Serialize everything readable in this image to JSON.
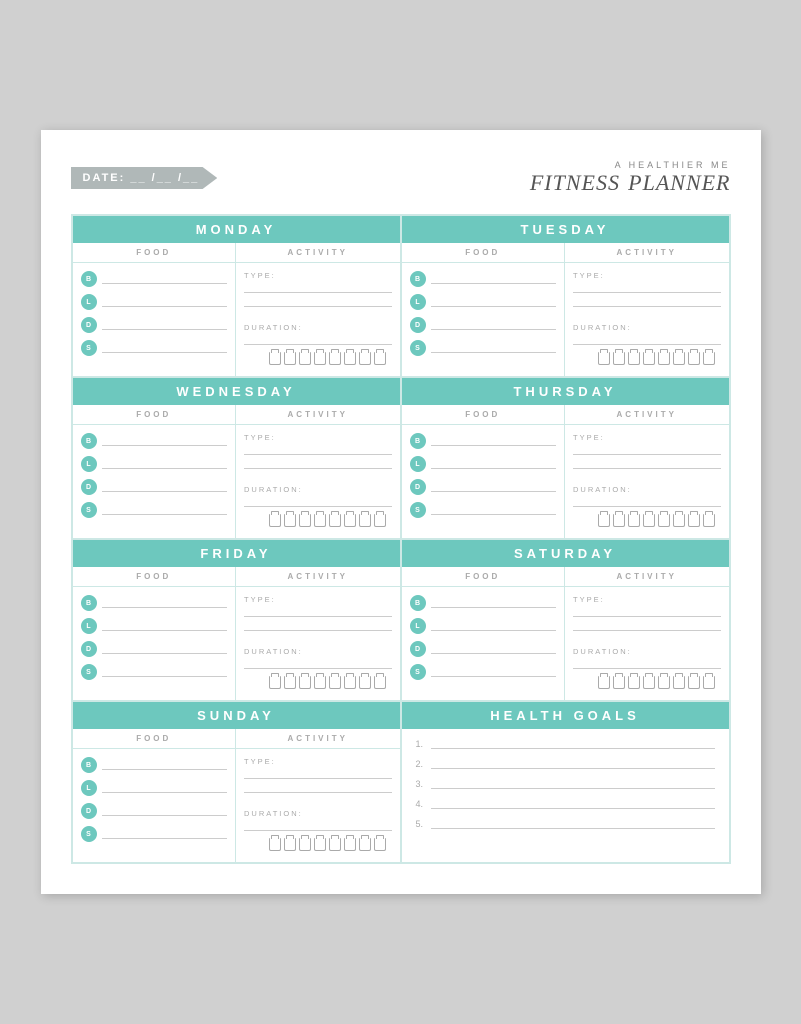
{
  "header": {
    "date_label": "DATE:  __ /__ /__ ",
    "brand_sub": "A HEALTHIER ME",
    "brand_fitness": "FITNESS",
    "brand_planner": "Planner"
  },
  "days": [
    {
      "name": "MONDAY",
      "meals": [
        "B",
        "L",
        "D",
        "S"
      ]
    },
    {
      "name": "TUESDAY",
      "meals": [
        "B",
        "L",
        "D",
        "S"
      ]
    },
    {
      "name": "WEDNESDAY",
      "meals": [
        "B",
        "L",
        "D",
        "S"
      ]
    },
    {
      "name": "THURSDAY",
      "meals": [
        "B",
        "L",
        "D",
        "S"
      ]
    },
    {
      "name": "FRIDAY",
      "meals": [
        "B",
        "L",
        "D",
        "S"
      ]
    },
    {
      "name": "SATURDAY",
      "meals": [
        "B",
        "L",
        "D",
        "S"
      ]
    },
    {
      "name": "SUNDAY",
      "meals": [
        "B",
        "L",
        "D",
        "S"
      ]
    }
  ],
  "col_labels": {
    "food": "FOOD",
    "activity": "ACTIVITY"
  },
  "activity_labels": {
    "type": "TYPE:",
    "duration": "DURATION:"
  },
  "health_goals": {
    "header": "HEALTH GOALS",
    "items": [
      "1.",
      "2.",
      "3.",
      "4.",
      "5."
    ]
  },
  "water_cups": 8,
  "colors": {
    "teal": "#6dc8be",
    "light_teal_border": "#cde8e5",
    "gray_header": "#b0b8b8"
  }
}
